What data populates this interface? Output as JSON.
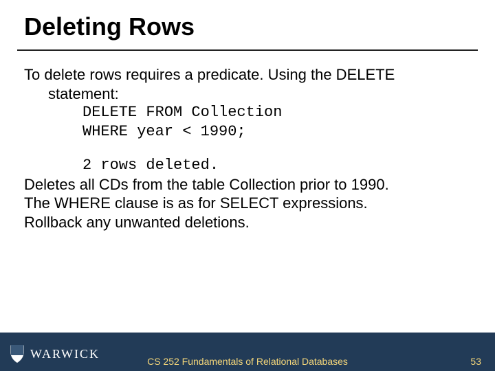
{
  "title": "Deleting Rows",
  "body": {
    "intro1": "To delete rows requires a predicate. Using the DELETE",
    "intro2": "statement:",
    "code1": "DELETE FROM Collection",
    "code2": "WHERE year < 1990;",
    "result": "2 rows deleted.",
    "line1": "Deletes all CDs from the table Collection prior to 1990.",
    "line2": "The WHERE clause is as for SELECT expressions.",
    "line3": "Rollback any unwanted deletions."
  },
  "footer": {
    "brand": "WARWICK",
    "course": "CS 252 Fundamentals of Relational Databases",
    "page": "53"
  }
}
